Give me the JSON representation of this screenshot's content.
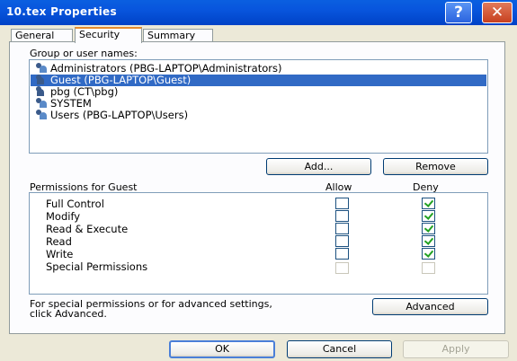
{
  "window": {
    "title": "10.tex Properties",
    "help_label": "?",
    "close_label": "✕"
  },
  "tabs": [
    {
      "label": "General",
      "active": false
    },
    {
      "label": "Security",
      "active": true
    },
    {
      "label": "Summary",
      "active": false
    }
  ],
  "groups": {
    "heading": "Group or user names:",
    "items": [
      {
        "label": "Administrators (PBG-LAPTOP\\Administrators)",
        "icon": "group-icon",
        "selected": false
      },
      {
        "label": "Guest (PBG-LAPTOP\\Guest)",
        "icon": "user-icon",
        "selected": true
      },
      {
        "label": "pbg (CT\\pbg)",
        "icon": "user-icon",
        "selected": false
      },
      {
        "label": "SYSTEM",
        "icon": "group-icon",
        "selected": false
      },
      {
        "label": "Users (PBG-LAPTOP\\Users)",
        "icon": "group-icon",
        "selected": false
      }
    ],
    "add_label": "Add...",
    "remove_label": "Remove"
  },
  "permissions": {
    "heading": "Permissions for Guest",
    "allow_header": "Allow",
    "deny_header": "Deny",
    "rows": [
      {
        "label": "Full Control",
        "allow": false,
        "deny": true,
        "enabled": true
      },
      {
        "label": "Modify",
        "allow": false,
        "deny": true,
        "enabled": true
      },
      {
        "label": "Read & Execute",
        "allow": false,
        "deny": true,
        "enabled": true
      },
      {
        "label": "Read",
        "allow": false,
        "deny": true,
        "enabled": true
      },
      {
        "label": "Write",
        "allow": false,
        "deny": true,
        "enabled": true
      },
      {
        "label": "Special Permissions",
        "allow": false,
        "deny": false,
        "enabled": false
      }
    ]
  },
  "advanced": {
    "text_line1": "For special permissions or for advanced settings,",
    "text_line2": "click Advanced.",
    "button_label": "Advanced"
  },
  "footer": {
    "ok_label": "OK",
    "cancel_label": "Cancel",
    "apply_label": "Apply"
  }
}
